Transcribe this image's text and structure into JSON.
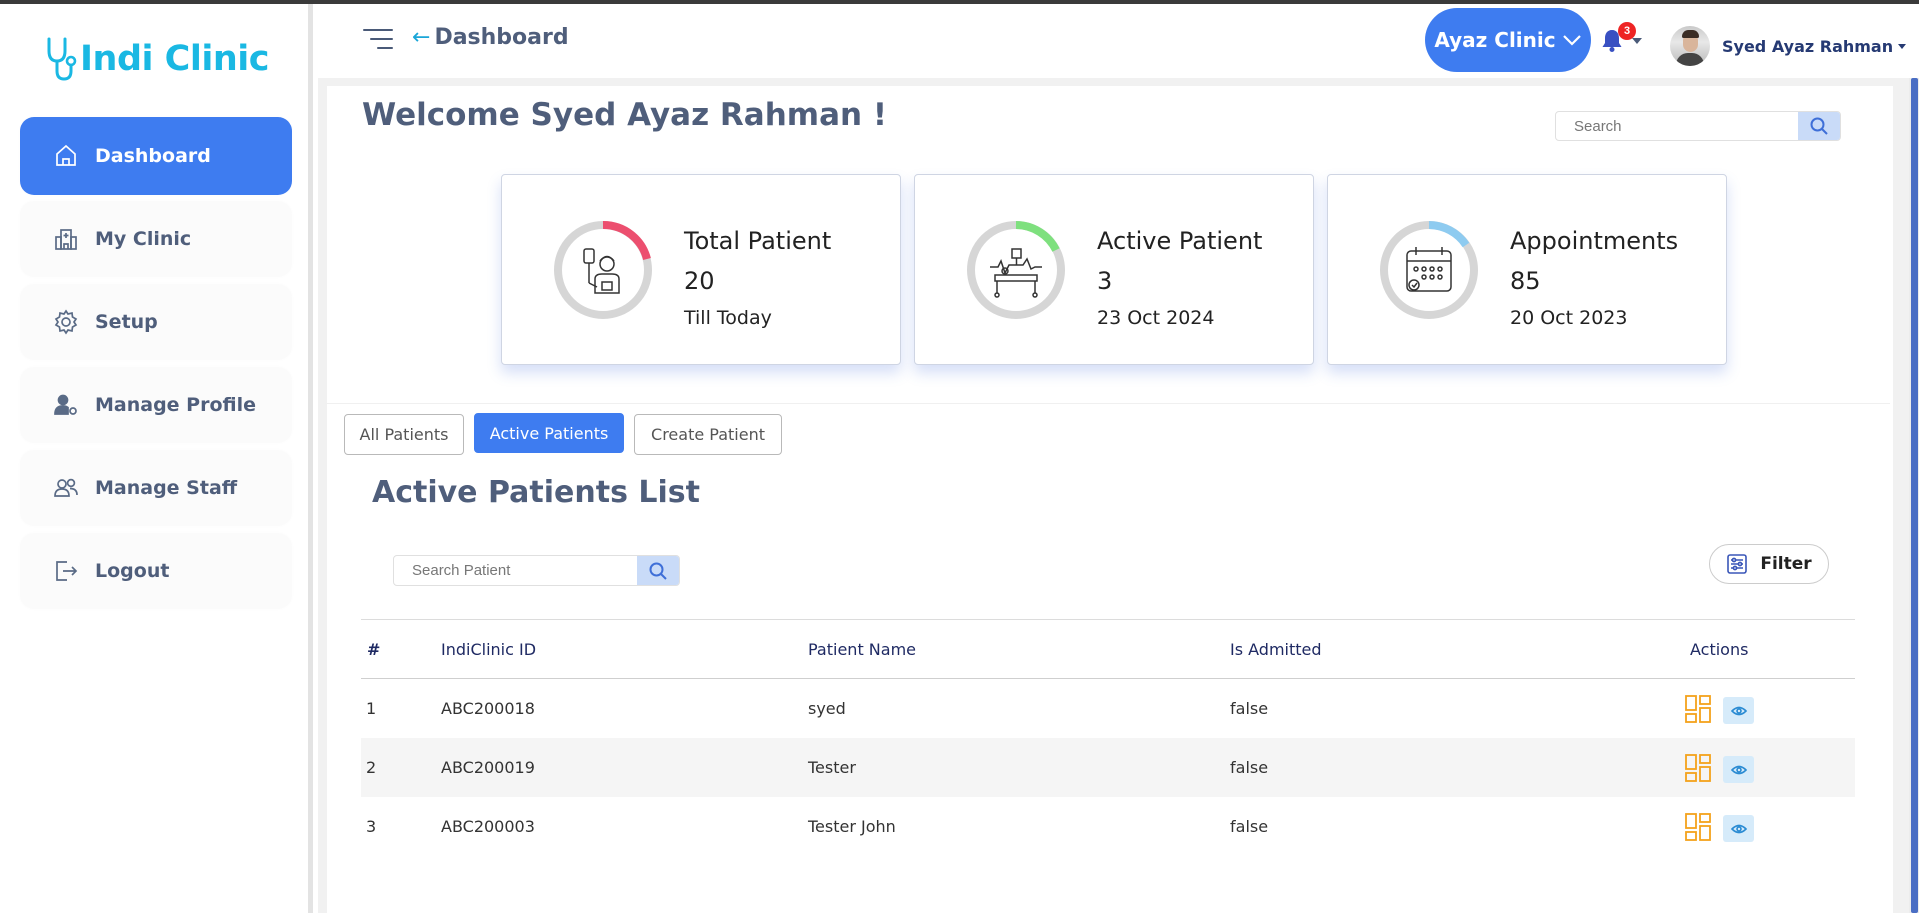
{
  "app": {
    "logo_text": "Indi Clinic",
    "accent": "#3e7cf0",
    "brand_color": "#1ab8e3"
  },
  "sidebar": {
    "items": [
      {
        "label": "Dashboard",
        "icon": "home-icon",
        "active": true
      },
      {
        "label": "My Clinic",
        "icon": "hospital-icon"
      },
      {
        "label": "Setup",
        "icon": "gear-icon"
      },
      {
        "label": "Manage Profile",
        "icon": "user-gear-icon"
      },
      {
        "label": "Manage Staff",
        "icon": "users-icon"
      },
      {
        "label": "Logout",
        "icon": "logout-icon"
      }
    ]
  },
  "header": {
    "back_arrow": "←",
    "title": "Dashboard",
    "clinic_selector": "Ayaz Clinic",
    "notification_count": "3",
    "user_name": "Syed Ayaz Rahman"
  },
  "main": {
    "welcome": "Welcome Syed Ayaz Rahman !",
    "search_placeholder": "Search",
    "cards": [
      {
        "title": "Total Patient",
        "value": "20",
        "sub": "Till Today",
        "ring_color": "#ec4f6f",
        "icon": "patient-drip-icon"
      },
      {
        "title": "Active Patient",
        "value": "3",
        "sub": "23 Oct 2024",
        "ring_color": "#7ee07e",
        "icon": "hospital-bed-icon"
      },
      {
        "title": "Appointments",
        "value": "85",
        "sub": "20 Oct 2023",
        "ring_color": "#8ecbf0",
        "icon": "calendar-icon"
      }
    ],
    "tabs": [
      {
        "label": "All Patients"
      },
      {
        "label": "Active Patients",
        "active": true
      },
      {
        "label": "Create Patient"
      }
    ],
    "list_title": "Active Patients List",
    "patient_search_placeholder": "Search Patient",
    "filter_label": "Filter",
    "table": {
      "columns": [
        "#",
        "IndiClinic ID",
        "Patient Name",
        "Is Admitted",
        "Actions"
      ],
      "rows": [
        {
          "num": "1",
          "id": "ABC200018",
          "name": "syed",
          "admitted": "false"
        },
        {
          "num": "2",
          "id": "ABC200019",
          "name": "Tester",
          "admitted": "false"
        },
        {
          "num": "3",
          "id": "ABC200003",
          "name": "Tester John",
          "admitted": "false"
        }
      ]
    }
  }
}
